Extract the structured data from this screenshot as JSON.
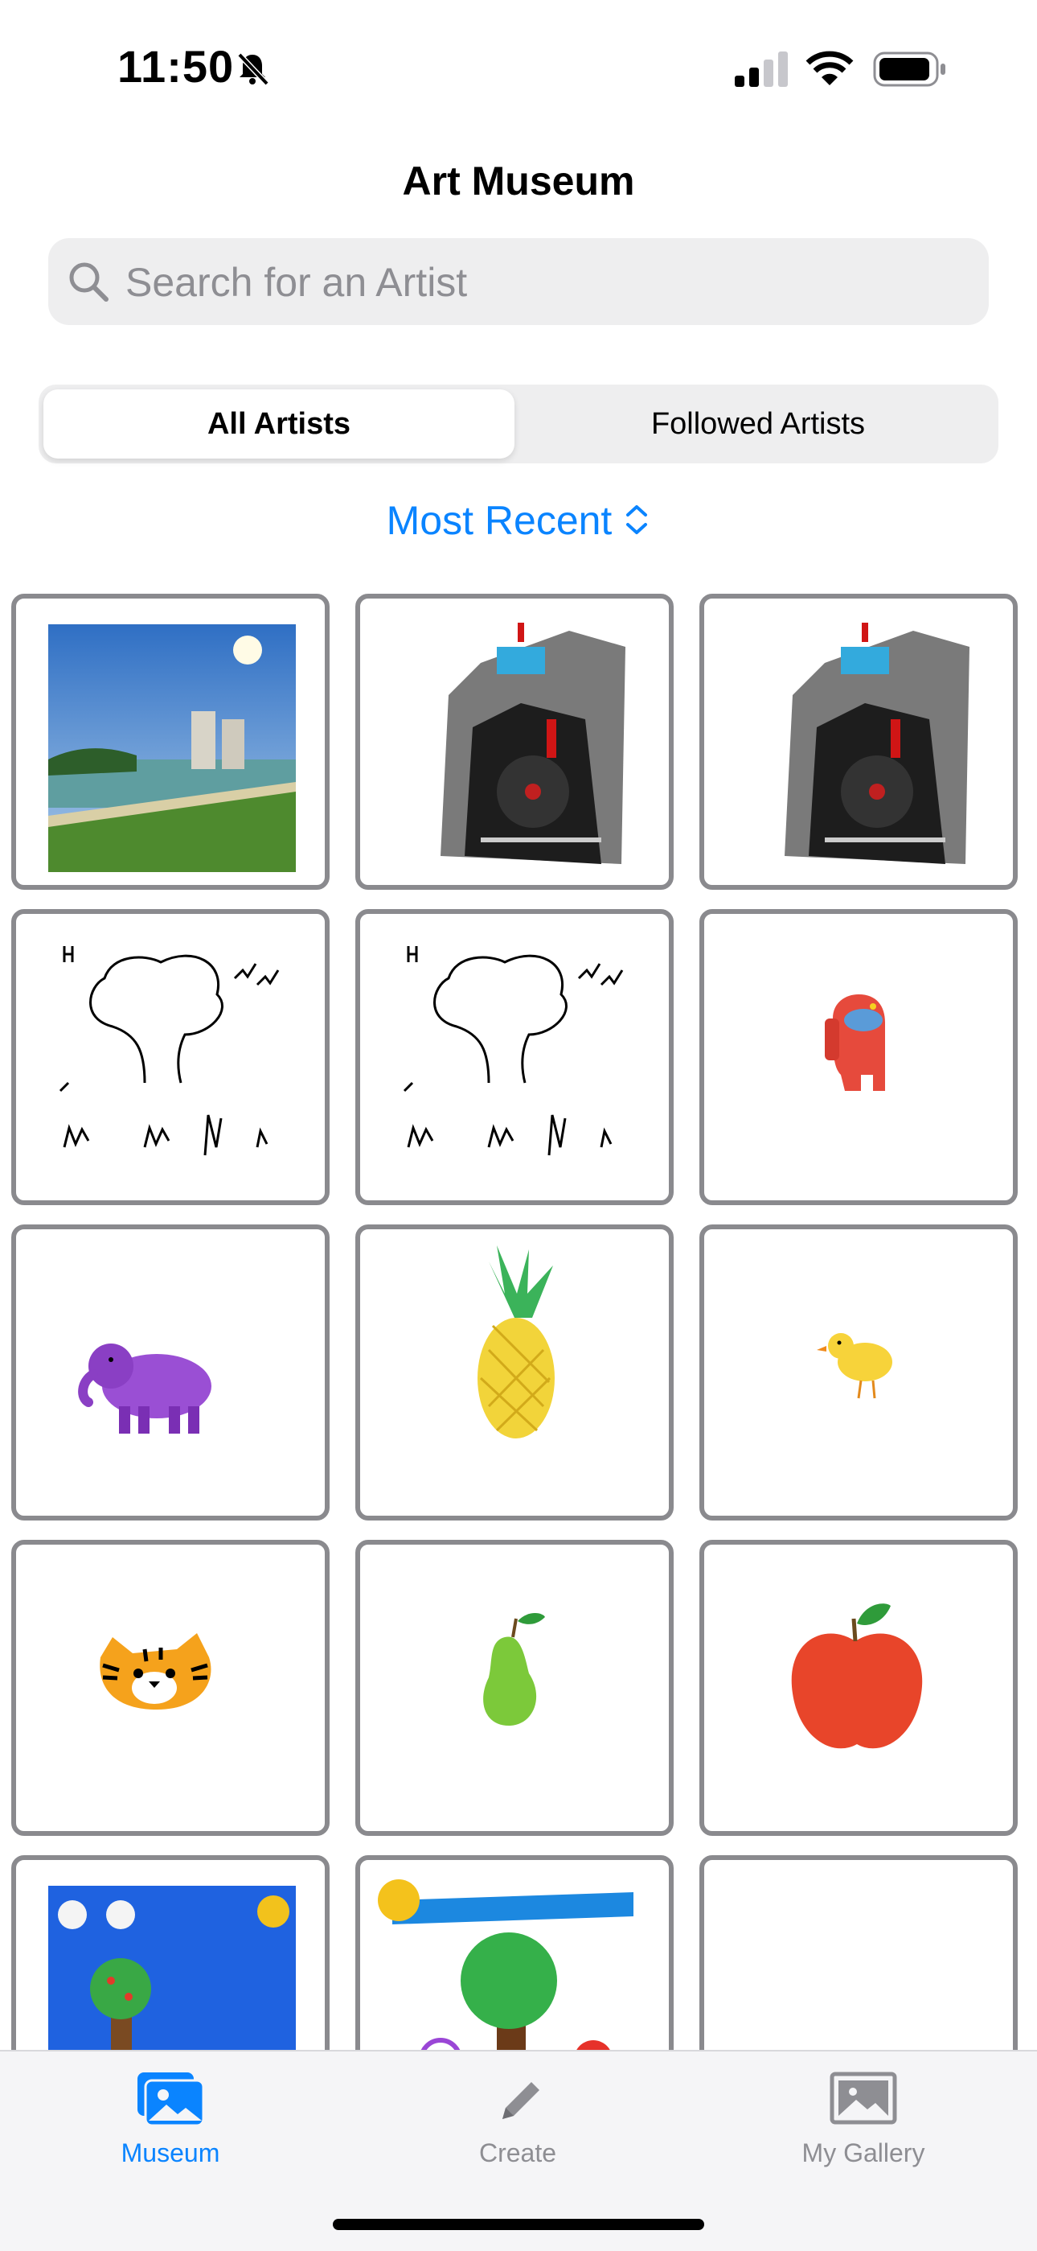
{
  "status_bar": {
    "time": "11:50",
    "icons": [
      "bell-slash-icon",
      "cellular-signal-icon",
      "wifi-icon",
      "battery-icon"
    ]
  },
  "header": {
    "title": "Art Museum"
  },
  "search": {
    "placeholder": "Search for an Artist",
    "value": ""
  },
  "segments": {
    "all_label": "All Artists",
    "followed_label": "Followed Artists",
    "selected": "All Artists"
  },
  "sort": {
    "label": "Most Recent"
  },
  "gallery": {
    "tiles": [
      "landscape-photo",
      "robot-sketch",
      "robot-sketch",
      "tree-birds-sketch",
      "tree-birds-sketch",
      "red-astronaut",
      "purple-elephant",
      "pineapple",
      "yellow-chick",
      "tiger-face",
      "green-pear",
      "red-apple",
      "blue-tree-scene",
      "tree-flowers-scene",
      "blank"
    ]
  },
  "tab_bar": {
    "museum_label": "Museum",
    "create_label": "Create",
    "gallery_label": "My Gallery",
    "active": "Museum"
  },
  "colors": {
    "accent": "#0a84ff",
    "tile_border": "#8a8a8e",
    "inactive": "#8e8e93"
  }
}
